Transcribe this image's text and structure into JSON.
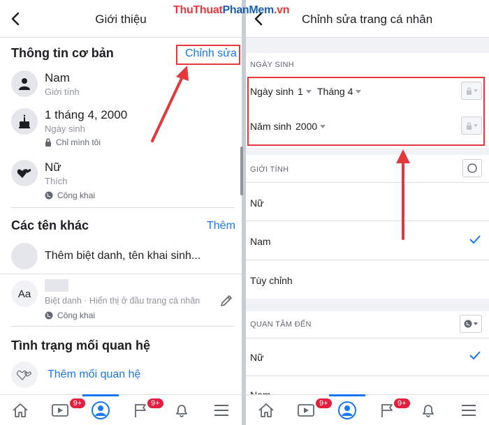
{
  "left": {
    "header_title": "Giới thiệu",
    "basic_info": {
      "title": "Thông tin cơ bản",
      "edit_label": "Chỉnh sửa",
      "gender_value": "Nam",
      "gender_label": "Giới tính",
      "birthday_value": "1 tháng 4, 2000",
      "birthday_label": "Ngày sinh",
      "birthday_privacy": "Chỉ mình tôi",
      "interest_value": "Nữ",
      "interest_label": "Thích",
      "interest_privacy": "Công khai"
    },
    "other_names": {
      "title": "Các tên khác",
      "add_label": "Thêm",
      "add_nickname": "Thêm biệt danh, tên khai sinh...",
      "nickname_label": "Biệt danh · Hiển thị ở đầu trang cá nhân",
      "nickname_privacy": "Công khai",
      "aa_icon_text": "Aa"
    },
    "relationship": {
      "title": "Tình trạng mối quan hệ",
      "add_label": "Thêm mối quan hệ"
    }
  },
  "right": {
    "header_title": "Chỉnh sửa trang cá nhân",
    "birthday_caption": "NGÀY SINH",
    "birth_date_label": "Ngày sinh",
    "day_value": "1",
    "month_value": "Tháng 4",
    "birth_year_label": "Năm sinh",
    "year_value": "2000",
    "gender_caption": "GIỚI TÍNH",
    "gender_options": [
      "Nữ",
      "Nam",
      "Tùy chỉnh"
    ],
    "gender_selected": "Nam",
    "interest_caption": "QUAN TÂM ĐẾN",
    "interest_options": [
      "Nữ",
      "Nam"
    ],
    "interest_selected": "Nữ"
  },
  "tabbar": {
    "video_badge": "9+",
    "pages_badge": "9+"
  },
  "watermark": {
    "part1": "ThuThuat",
    "part2": "PhanMem",
    "part3": ".vn"
  },
  "colors": {
    "accent": "#1877f2",
    "annotation_red": "#e4393c",
    "badge_red": "#e41e3f"
  }
}
